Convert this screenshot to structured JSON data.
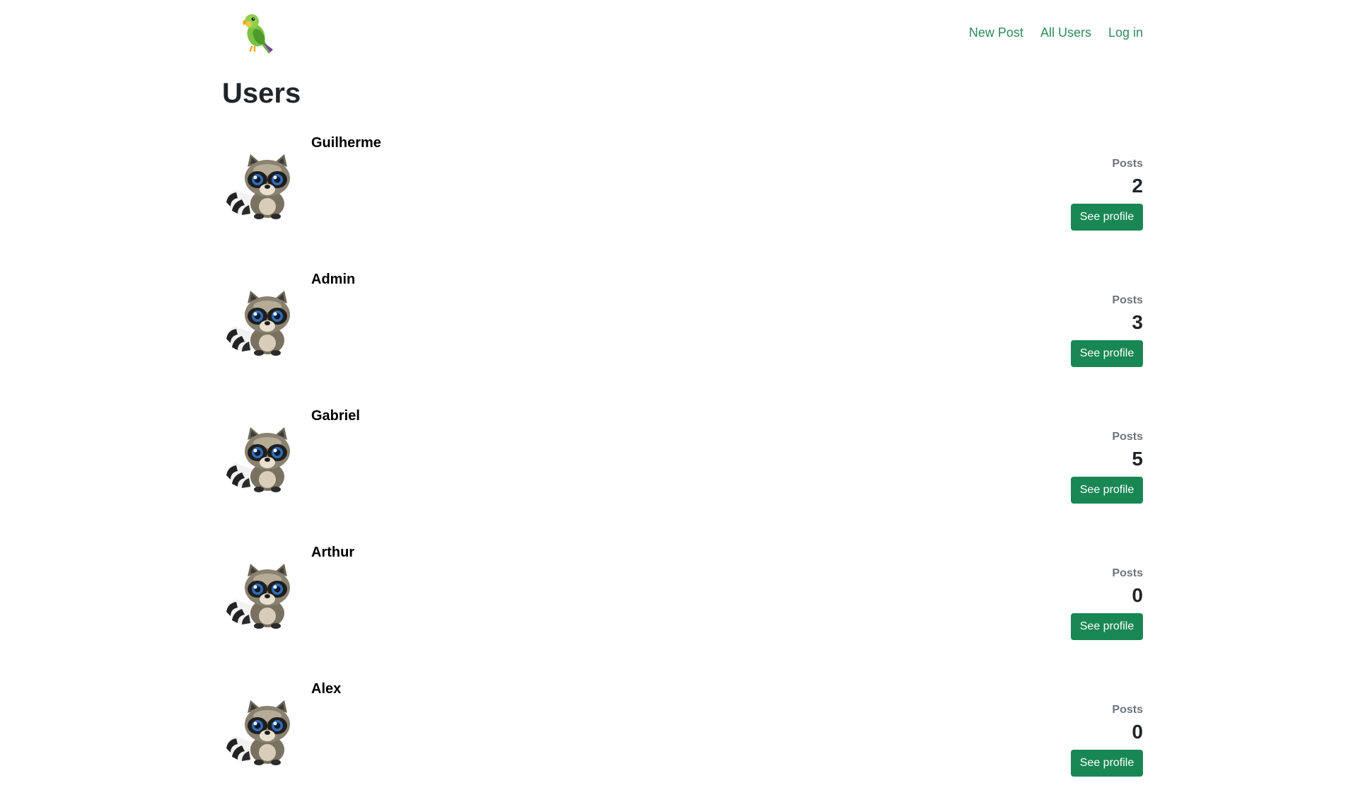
{
  "header": {
    "logo": "parrot-logo",
    "nav": [
      {
        "label": "New Post"
      },
      {
        "label": "All Users"
      },
      {
        "label": "Log in"
      }
    ],
    "link_color": "#2e8b57"
  },
  "main": {
    "title": "Users",
    "posts_label": "Posts",
    "button_label": "See profile",
    "button_color": "#198754",
    "users": [
      {
        "name": "Guilherme",
        "posts": "2",
        "avatar": "raccoon-avatar"
      },
      {
        "name": "Admin",
        "posts": "3",
        "avatar": "raccoon-avatar"
      },
      {
        "name": "Gabriel",
        "posts": "5",
        "avatar": "raccoon-avatar"
      },
      {
        "name": "Arthur",
        "posts": "0",
        "avatar": "raccoon-avatar"
      },
      {
        "name": "Alex",
        "posts": "0",
        "avatar": "raccoon-avatar"
      }
    ]
  }
}
